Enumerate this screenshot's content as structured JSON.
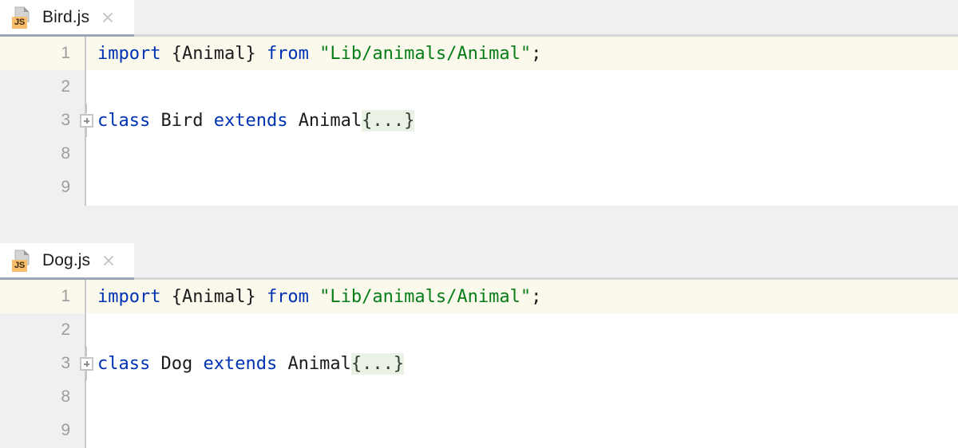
{
  "theme": {
    "keyword_color": "#0033b3",
    "string_color": "#067d17",
    "text_color": "#1c1c1c",
    "current_line_bg": "#fbf8ec",
    "fold_placeholder_bg": "#e9f2e5",
    "gutter_bg": "#f0f0f0",
    "line_number_color": "#9d9d9d",
    "active_tab_underline": "#9aa7b7",
    "js_badge_color": "#f5bd6c"
  },
  "panes": [
    {
      "id": "bird",
      "tab": {
        "label": "Bird.js",
        "icon": "javascript-file-icon",
        "badge": "JS",
        "close_icon": "close-icon",
        "active": true
      },
      "line_numbers": [
        "1",
        "2",
        "3",
        "8",
        "9"
      ],
      "current_line_index": 0,
      "fold_marker_row_index": 2,
      "lines": [
        {
          "number": "1",
          "tokens": [
            {
              "text": "import ",
              "type": "keyword"
            },
            {
              "text": "{Animal} ",
              "type": "plain"
            },
            {
              "text": "from ",
              "type": "keyword"
            },
            {
              "text": "\"Lib/animals/Animal\"",
              "type": "string"
            },
            {
              "text": ";",
              "type": "plain"
            }
          ]
        },
        {
          "number": "2",
          "tokens": []
        },
        {
          "number": "3",
          "tokens": [
            {
              "text": "class ",
              "type": "keyword"
            },
            {
              "text": "Bird ",
              "type": "plain"
            },
            {
              "text": "extends ",
              "type": "keyword"
            },
            {
              "text": "Animal",
              "type": "plain"
            },
            {
              "text": "{...}",
              "type": "fold"
            }
          ]
        },
        {
          "number": "8",
          "tokens": []
        },
        {
          "number": "9",
          "tokens": []
        }
      ]
    },
    {
      "id": "dog",
      "tab": {
        "label": "Dog.js",
        "icon": "javascript-file-icon",
        "badge": "JS",
        "close_icon": "close-icon",
        "active": true
      },
      "line_numbers": [
        "1",
        "2",
        "3",
        "8",
        "9"
      ],
      "current_line_index": 0,
      "fold_marker_row_index": 2,
      "lines": [
        {
          "number": "1",
          "tokens": [
            {
              "text": "import ",
              "type": "keyword"
            },
            {
              "text": "{Animal} ",
              "type": "plain"
            },
            {
              "text": "from ",
              "type": "keyword"
            },
            {
              "text": "\"Lib/animals/Animal\"",
              "type": "string"
            },
            {
              "text": ";",
              "type": "plain"
            }
          ]
        },
        {
          "number": "2",
          "tokens": []
        },
        {
          "number": "3",
          "tokens": [
            {
              "text": "class ",
              "type": "keyword"
            },
            {
              "text": "Dog ",
              "type": "plain"
            },
            {
              "text": "extends ",
              "type": "keyword"
            },
            {
              "text": "Animal",
              "type": "plain"
            },
            {
              "text": "{...}",
              "type": "fold"
            }
          ]
        },
        {
          "number": "8",
          "tokens": []
        },
        {
          "number": "9",
          "tokens": []
        }
      ]
    }
  ]
}
